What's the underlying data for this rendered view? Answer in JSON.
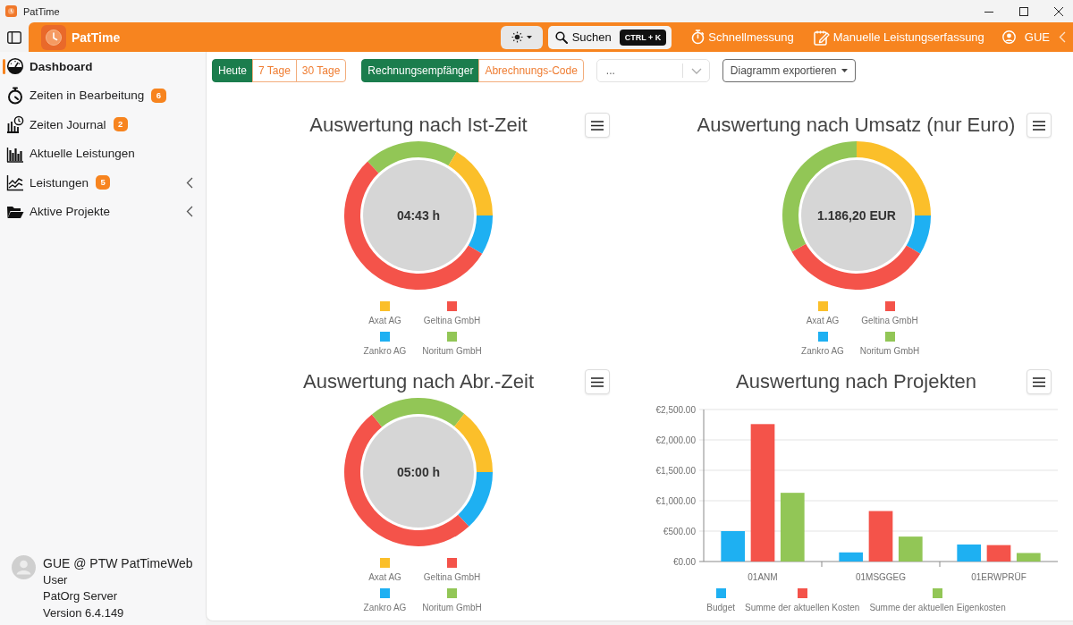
{
  "window": {
    "title": "PatTime"
  },
  "header": {
    "app_name": "PatTime",
    "search": {
      "label": "Suchen",
      "shortcut": "CTRL + K"
    },
    "actions": [
      {
        "label": "Schnellmessung"
      },
      {
        "label": "Manuelle Leistungserfassung"
      }
    ],
    "user": {
      "name": "GUE"
    }
  },
  "sidebar": {
    "items": [
      {
        "label": "Dashboard",
        "selected": true
      },
      {
        "label": "Zeiten in Bearbeitung",
        "selected": false,
        "badge": "6"
      },
      {
        "label": "Zeiten Journal",
        "selected": false,
        "badge": "2"
      },
      {
        "label": "Aktuelle Leistungen",
        "selected": false
      },
      {
        "label": "Leistungen",
        "selected": false,
        "badge": "5",
        "expanded": false
      },
      {
        "label": "Aktive Projekte",
        "selected": false,
        "expanded": false
      }
    ],
    "account": {
      "name": "GUE @ PTW PatTimeWeb",
      "role": "User",
      "server": "PatOrg Server",
      "version": "Version 6.4.149"
    }
  },
  "toolbar": {
    "periods": [
      {
        "label": "Heute",
        "selected": true
      },
      {
        "label": "7 Tage",
        "selected": false
      },
      {
        "label": "30 Tage",
        "selected": false
      }
    ],
    "grouping": [
      {
        "label": "Rechnungsempfänger",
        "selected": true
      },
      {
        "label": "Abrechnungs-Code",
        "selected": false
      }
    ],
    "filter": {
      "placeholder": "..."
    },
    "export_button": "Diagramm exportieren"
  },
  "charts": [
    {
      "center_label": "04:43 h",
      "chart_data": {
        "type": "donut",
        "title": "Auswertung nach Ist-Zeit",
        "categories": [
          "Axat AG",
          "Geltina GmbH",
          "Zankro AG",
          "Noritum GmbH"
        ],
        "values": [
          16.4,
          54.4,
          8.6,
          20.6
        ],
        "colors": [
          "#fbbf2a",
          "#f4534a",
          "#1eb0f2",
          "#92c656"
        ],
        "legend": "bottom"
      }
    },
    {
      "center_label": "1.186,20 EUR",
      "chart_data": {
        "type": "donut",
        "title": "Auswertung nach Umsatz (nur Euro)",
        "categories": [
          "Axat AG",
          "Geltina GmbH",
          "Zankro AG",
          "Noritum GmbH"
        ],
        "values": [
          25.0,
          33.3,
          8.6,
          33.1
        ],
        "colors": [
          "#fbbf2a",
          "#f4534a",
          "#1eb0f2",
          "#92c656"
        ],
        "legend": "bottom"
      }
    },
    {
      "center_label": "05:00 h",
      "chart_data": {
        "type": "donut",
        "title": "Auswertung nach Abr.-Zeit",
        "categories": [
          "Axat AG",
          "Geltina GmbH",
          "Zankro AG",
          "Noritum GmbH"
        ],
        "values": [
          14.4,
          51.1,
          13.1,
          21.4
        ],
        "colors": [
          "#fbbf2a",
          "#f4534a",
          "#1eb0f2",
          "#92c656"
        ],
        "legend": "bottom"
      }
    },
    {
      "chart_data": {
        "type": "bar",
        "title": "Auswertung nach Projekten",
        "categories": [
          "01ANM",
          "01MSGGEG",
          "01ERWPRÜF"
        ],
        "series": [
          {
            "name": "Budget",
            "color": "#1eb0f2",
            "values": [
              500,
              150,
              280
            ]
          },
          {
            "name": "Summe der aktuellen Kosten",
            "color": "#f4534a",
            "values": [
              2260,
              830,
              270
            ]
          },
          {
            "name": "Summe der aktuellen Eigenkosten",
            "color": "#92c656",
            "values": [
              1130,
              410,
              140
            ]
          }
        ],
        "ylim": [
          0,
          2500
        ],
        "yticks": [
          {
            "value": 0,
            "label": "€0.00"
          },
          {
            "value": 500,
            "label": "€500.00"
          },
          {
            "value": 1000,
            "label": "€1,000.00"
          },
          {
            "value": 1500,
            "label": "€1,500.00"
          },
          {
            "value": 2000,
            "label": "€2,000.00"
          },
          {
            "value": 2500,
            "label": "€2,500.00"
          }
        ],
        "grid": true,
        "legend": "bottom"
      }
    }
  ]
}
